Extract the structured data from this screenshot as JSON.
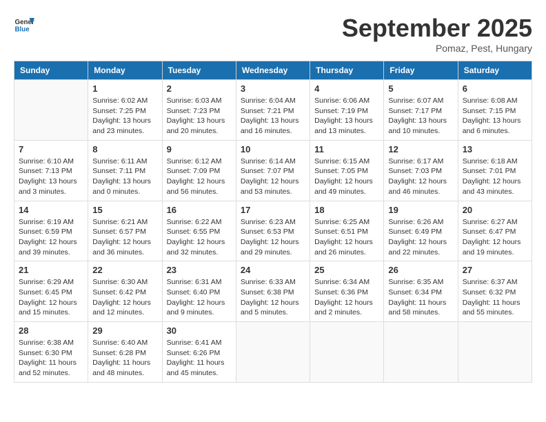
{
  "header": {
    "logo_line1": "General",
    "logo_line2": "Blue",
    "month": "September 2025",
    "location": "Pomaz, Pest, Hungary"
  },
  "weekdays": [
    "Sunday",
    "Monday",
    "Tuesday",
    "Wednesday",
    "Thursday",
    "Friday",
    "Saturday"
  ],
  "weeks": [
    [
      {
        "day": "",
        "info": ""
      },
      {
        "day": "1",
        "info": "Sunrise: 6:02 AM\nSunset: 7:25 PM\nDaylight: 13 hours\nand 23 minutes."
      },
      {
        "day": "2",
        "info": "Sunrise: 6:03 AM\nSunset: 7:23 PM\nDaylight: 13 hours\nand 20 minutes."
      },
      {
        "day": "3",
        "info": "Sunrise: 6:04 AM\nSunset: 7:21 PM\nDaylight: 13 hours\nand 16 minutes."
      },
      {
        "day": "4",
        "info": "Sunrise: 6:06 AM\nSunset: 7:19 PM\nDaylight: 13 hours\nand 13 minutes."
      },
      {
        "day": "5",
        "info": "Sunrise: 6:07 AM\nSunset: 7:17 PM\nDaylight: 13 hours\nand 10 minutes."
      },
      {
        "day": "6",
        "info": "Sunrise: 6:08 AM\nSunset: 7:15 PM\nDaylight: 13 hours\nand 6 minutes."
      }
    ],
    [
      {
        "day": "7",
        "info": "Sunrise: 6:10 AM\nSunset: 7:13 PM\nDaylight: 13 hours\nand 3 minutes."
      },
      {
        "day": "8",
        "info": "Sunrise: 6:11 AM\nSunset: 7:11 PM\nDaylight: 13 hours\nand 0 minutes."
      },
      {
        "day": "9",
        "info": "Sunrise: 6:12 AM\nSunset: 7:09 PM\nDaylight: 12 hours\nand 56 minutes."
      },
      {
        "day": "10",
        "info": "Sunrise: 6:14 AM\nSunset: 7:07 PM\nDaylight: 12 hours\nand 53 minutes."
      },
      {
        "day": "11",
        "info": "Sunrise: 6:15 AM\nSunset: 7:05 PM\nDaylight: 12 hours\nand 49 minutes."
      },
      {
        "day": "12",
        "info": "Sunrise: 6:17 AM\nSunset: 7:03 PM\nDaylight: 12 hours\nand 46 minutes."
      },
      {
        "day": "13",
        "info": "Sunrise: 6:18 AM\nSunset: 7:01 PM\nDaylight: 12 hours\nand 43 minutes."
      }
    ],
    [
      {
        "day": "14",
        "info": "Sunrise: 6:19 AM\nSunset: 6:59 PM\nDaylight: 12 hours\nand 39 minutes."
      },
      {
        "day": "15",
        "info": "Sunrise: 6:21 AM\nSunset: 6:57 PM\nDaylight: 12 hours\nand 36 minutes."
      },
      {
        "day": "16",
        "info": "Sunrise: 6:22 AM\nSunset: 6:55 PM\nDaylight: 12 hours\nand 32 minutes."
      },
      {
        "day": "17",
        "info": "Sunrise: 6:23 AM\nSunset: 6:53 PM\nDaylight: 12 hours\nand 29 minutes."
      },
      {
        "day": "18",
        "info": "Sunrise: 6:25 AM\nSunset: 6:51 PM\nDaylight: 12 hours\nand 26 minutes."
      },
      {
        "day": "19",
        "info": "Sunrise: 6:26 AM\nSunset: 6:49 PM\nDaylight: 12 hours\nand 22 minutes."
      },
      {
        "day": "20",
        "info": "Sunrise: 6:27 AM\nSunset: 6:47 PM\nDaylight: 12 hours\nand 19 minutes."
      }
    ],
    [
      {
        "day": "21",
        "info": "Sunrise: 6:29 AM\nSunset: 6:45 PM\nDaylight: 12 hours\nand 15 minutes."
      },
      {
        "day": "22",
        "info": "Sunrise: 6:30 AM\nSunset: 6:42 PM\nDaylight: 12 hours\nand 12 minutes."
      },
      {
        "day": "23",
        "info": "Sunrise: 6:31 AM\nSunset: 6:40 PM\nDaylight: 12 hours\nand 9 minutes."
      },
      {
        "day": "24",
        "info": "Sunrise: 6:33 AM\nSunset: 6:38 PM\nDaylight: 12 hours\nand 5 minutes."
      },
      {
        "day": "25",
        "info": "Sunrise: 6:34 AM\nSunset: 6:36 PM\nDaylight: 12 hours\nand 2 minutes."
      },
      {
        "day": "26",
        "info": "Sunrise: 6:35 AM\nSunset: 6:34 PM\nDaylight: 11 hours\nand 58 minutes."
      },
      {
        "day": "27",
        "info": "Sunrise: 6:37 AM\nSunset: 6:32 PM\nDaylight: 11 hours\nand 55 minutes."
      }
    ],
    [
      {
        "day": "28",
        "info": "Sunrise: 6:38 AM\nSunset: 6:30 PM\nDaylight: 11 hours\nand 52 minutes."
      },
      {
        "day": "29",
        "info": "Sunrise: 6:40 AM\nSunset: 6:28 PM\nDaylight: 11 hours\nand 48 minutes."
      },
      {
        "day": "30",
        "info": "Sunrise: 6:41 AM\nSunset: 6:26 PM\nDaylight: 11 hours\nand 45 minutes."
      },
      {
        "day": "",
        "info": ""
      },
      {
        "day": "",
        "info": ""
      },
      {
        "day": "",
        "info": ""
      },
      {
        "day": "",
        "info": ""
      }
    ]
  ]
}
